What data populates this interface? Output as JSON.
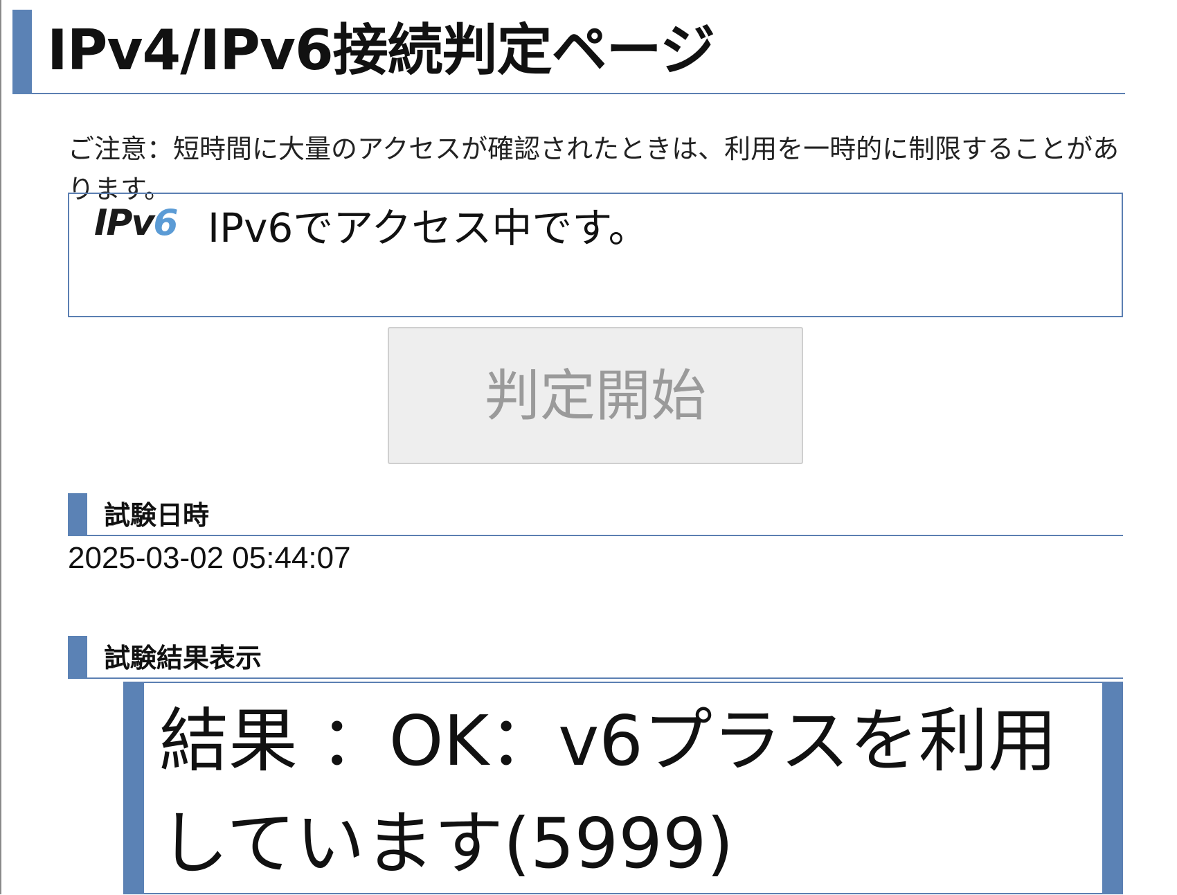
{
  "page": {
    "title": "IPv4/IPv6接続判定ページ",
    "notice": "ご注意：短時間に大量のアクセスが確認されたときは、利用を一時的に制限することがあります。"
  },
  "status": {
    "logo_prefix": "IPv",
    "logo_suffix": "6",
    "text": "IPv6でアクセス中です。"
  },
  "actions": {
    "start_label": "判定開始"
  },
  "test_datetime": {
    "heading": "試験日時",
    "value": "2025-03-02 05:44:07"
  },
  "test_result": {
    "heading": "試験結果表示",
    "text": "結果 ：OK：v6プラスを利用しています(5999)"
  },
  "colors": {
    "accent_bar": "#5b82b5",
    "rule_line": "#5b7fb2",
    "ipv6_logo_six": "#5b9bd5",
    "button_bg": "#eeeeee",
    "button_text": "#9a9a9a"
  }
}
